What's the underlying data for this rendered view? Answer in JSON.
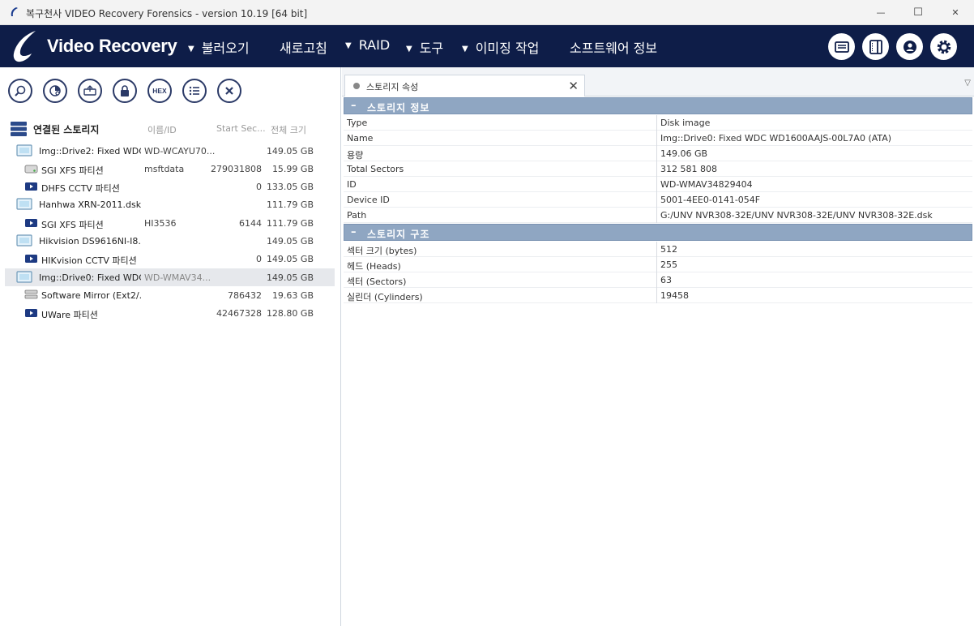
{
  "window": {
    "title": "복구천사 VIDEO Recovery Forensics - version 10.19 [64 bit]",
    "minimize_glyph": "—",
    "maximize_glyph": "☐",
    "close_glyph": "✕"
  },
  "navbar": {
    "brand": "Video Recovery",
    "menu": [
      {
        "label": "불러오기",
        "has_arrow": true
      },
      {
        "label": "새로고침",
        "has_arrow": false
      },
      {
        "label": "RAID",
        "has_arrow": true
      },
      {
        "label": "도구",
        "has_arrow": true
      },
      {
        "label": "이미징 작업",
        "has_arrow": true
      },
      {
        "label": "소프트웨어 정보",
        "has_arrow": false
      }
    ],
    "arrow_glyph": "▼",
    "icons": [
      "monitor-icon",
      "panel-icon",
      "user-icon",
      "settings-icon"
    ],
    "bg_color": "#0e1d48"
  },
  "toolbar": {
    "buttons": [
      "search-icon",
      "disk-scan-icon",
      "image-icon",
      "lock-icon",
      "hex-icon",
      "list-icon",
      "close-icon"
    ],
    "hex_label": "HEX"
  },
  "tree": {
    "header": {
      "label": "연결된 스토리지",
      "col_name": "이름/ID",
      "col_start": "Start Sec...",
      "col_size": "전체 크기"
    },
    "rows": [
      {
        "level": 0,
        "icon": "drive-image-icon",
        "name": "Img::Drive2: Fixed WDC...",
        "id": "WD-WCAYU70...",
        "start": "",
        "size": "149.05 GB",
        "selected": false
      },
      {
        "level": 1,
        "icon": "hdd-icon",
        "name": "SGI XFS 파티션",
        "id": "msftdata",
        "start": "279031808",
        "size": "15.99 GB",
        "selected": false
      },
      {
        "level": 1,
        "icon": "video-partition-icon",
        "name": "DHFS CCTV 파티션",
        "id": "",
        "start": "0",
        "size": "133.05 GB",
        "selected": false
      },
      {
        "level": 0,
        "icon": "drive-image-icon",
        "name": "Hanhwa XRN-2011.dsk",
        "id": "",
        "start": "",
        "size": "111.79 GB",
        "selected": false
      },
      {
        "level": 1,
        "icon": "video-partition-icon",
        "name": "SGI XFS 파티션",
        "id": "HI3536",
        "start": "6144",
        "size": "111.79 GB",
        "selected": false
      },
      {
        "level": 0,
        "icon": "drive-image-icon",
        "name": "Hikvision DS9616NI-I8...",
        "id": "",
        "start": "",
        "size": "149.05 GB",
        "selected": false
      },
      {
        "level": 1,
        "icon": "video-partition-icon",
        "name": "HIKvision CCTV 파티션",
        "id": "",
        "start": "0",
        "size": "149.05 GB",
        "selected": false
      },
      {
        "level": 0,
        "icon": "drive-image-icon",
        "name": "Img::Drive0: Fixed WDC...",
        "id": "WD-WMAV34...",
        "start": "",
        "size": "149.05 GB",
        "selected": true
      },
      {
        "level": 1,
        "icon": "raid-mirror-icon",
        "name": "Software Mirror (Ext2/...",
        "id": "",
        "start": "786432",
        "size": "19.63 GB",
        "selected": false
      },
      {
        "level": 1,
        "icon": "video-partition-icon",
        "name": "UWare 파티션",
        "id": "",
        "start": "42467328",
        "size": "128.80 GB",
        "selected": false
      }
    ]
  },
  "tab": {
    "label": "스토리지 속성",
    "close_glyph": "✕",
    "menu_glyph": "▽"
  },
  "properties": {
    "sections": [
      {
        "title": "스토리지 정보",
        "minus": "–",
        "rows": [
          {
            "key": "Type",
            "value": "Disk image"
          },
          {
            "key": "Name",
            "value": "Img::Drive0: Fixed WDC WD1600AAJS-00L7A0 (ATA)"
          },
          {
            "key": "용량",
            "value": "149.06 GB"
          },
          {
            "key": "Total Sectors",
            "value": "312 581 808"
          },
          {
            "key": "ID",
            "value": "WD-WMAV34829404"
          },
          {
            "key": "Device ID",
            "value": "5001-4EE0-0141-054F"
          },
          {
            "key": "Path",
            "value": "G:/UNV NVR308-32E/UNV NVR308-32E/UNV NVR308-32E.dsk"
          }
        ]
      },
      {
        "title": "스토리지 구조",
        "minus": "–",
        "rows": [
          {
            "key": "섹터 크기 (bytes)",
            "value": "512"
          },
          {
            "key": "헤드 (Heads)",
            "value": "255"
          },
          {
            "key": "섹터 (Sectors)",
            "value": "63"
          },
          {
            "key": "실린더 (Cylinders)",
            "value": "19458"
          }
        ]
      }
    ]
  }
}
